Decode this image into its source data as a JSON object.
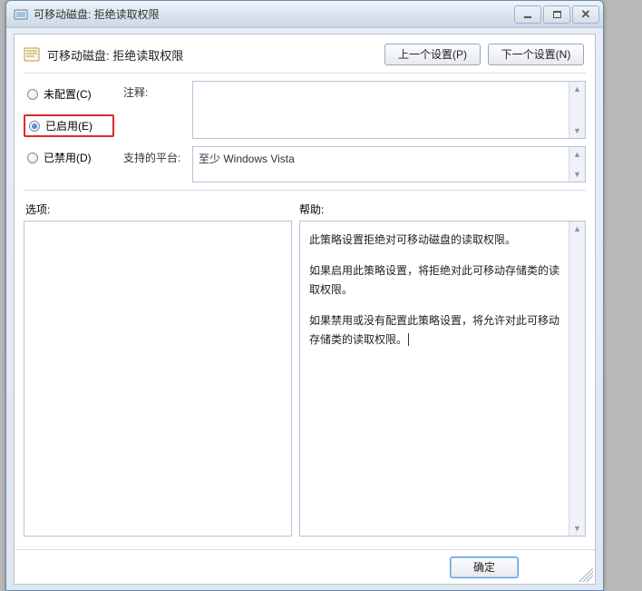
{
  "window": {
    "title": "可移动磁盘: 拒绝读取权限"
  },
  "header": {
    "title": "可移动磁盘: 拒绝读取权限",
    "prev_label": "上一个设置(P)",
    "next_label": "下一个设置(N)"
  },
  "radios": {
    "not_configured": "未配置(C)",
    "enabled": "已启用(E)",
    "disabled": "已禁用(D)",
    "selected": "enabled"
  },
  "fields": {
    "comment_label": "注释:",
    "comment_value": "",
    "platform_label": "支持的平台:",
    "platform_value": "至少 Windows Vista"
  },
  "sections": {
    "options_label": "选项:",
    "help_label": "帮助:"
  },
  "help": {
    "p1": "此策略设置拒绝对可移动磁盘的读取权限。",
    "p2": "如果启用此策略设置，将拒绝对此可移动存储类的读取权限。",
    "p3": "如果禁用或没有配置此策略设置，将允许对此可移动存储类的读取权限。"
  },
  "footer": {
    "ok_label": "确定"
  }
}
